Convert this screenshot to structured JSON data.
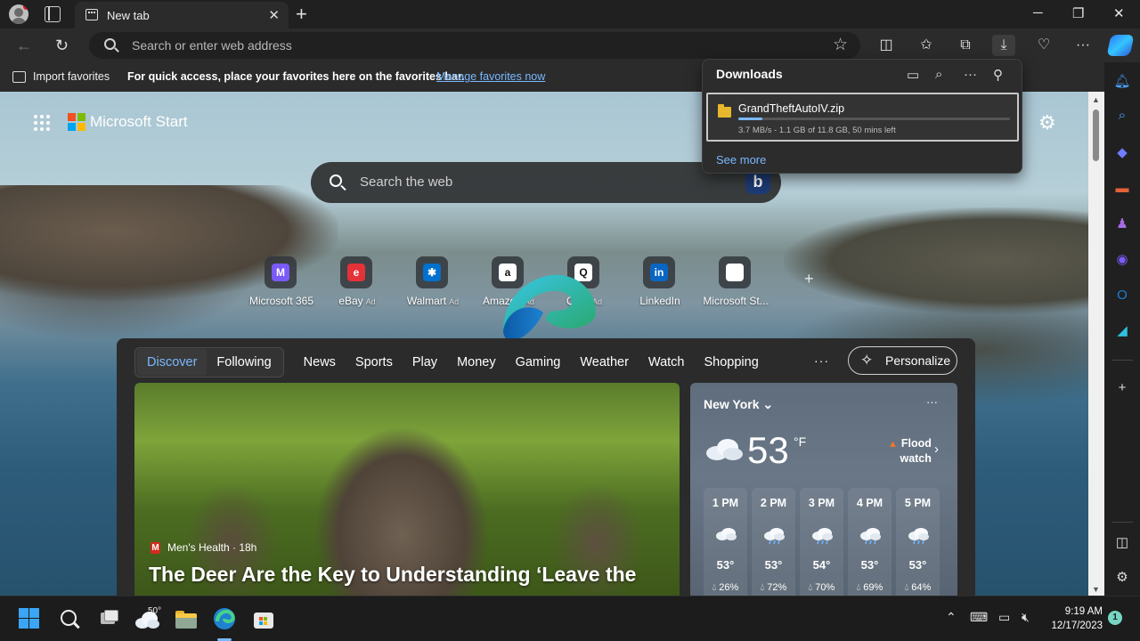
{
  "browser": {
    "tab": {
      "title": "New tab"
    },
    "address_bar": {
      "placeholder": "Search or enter web address"
    },
    "favorites_bar": {
      "import_label": "Import favorites",
      "message": "For quick access, place your favorites here on the favorites bar.",
      "manage_link": "Manage favorites now"
    }
  },
  "downloads": {
    "title": "Downloads",
    "items": [
      {
        "filename": "GrandTheftAutoIV.zip",
        "status": "3.7 MB/s - 1.1 GB of 11.8 GB, 50 mins left",
        "progress_percent": 9
      }
    ],
    "see_more": "See more"
  },
  "newtab": {
    "brand": "Microsoft Start",
    "search_placeholder": "Search the web",
    "quick_links": [
      {
        "label": "Microsoft 365",
        "ad": "",
        "color": "#7a5af8",
        "glyph": "M"
      },
      {
        "label": "eBay",
        "ad": "Ad",
        "color": "#e53238",
        "glyph": "e"
      },
      {
        "label": "Walmart",
        "ad": "Ad",
        "color": "#0071ce",
        "glyph": "✱"
      },
      {
        "label": "Amazon",
        "ad": "Ad",
        "color": "#ffffff",
        "glyph": "a"
      },
      {
        "label": "QVC",
        "ad": "Ad",
        "color": "#ffffff",
        "glyph": "Q"
      },
      {
        "label": "LinkedIn",
        "ad": "",
        "color": "#0a66c2",
        "glyph": "in"
      },
      {
        "label": "Microsoft St...",
        "ad": "",
        "color": "#ffffff",
        "glyph": ""
      }
    ],
    "feed_tabs": {
      "selected": "Discover",
      "secondary": "Following",
      "items": [
        "News",
        "Sports",
        "Play",
        "Money",
        "Gaming",
        "Weather",
        "Watch",
        "Shopping"
      ],
      "more": "···",
      "personalize": "Personalize"
    },
    "news_card": {
      "source": "Men's Health · 18h",
      "source_logo": "M",
      "headline": "The Deer Are the Key to Understanding ‘Leave the"
    },
    "weather": {
      "city": "New York",
      "temperature": "53",
      "unit": "°F",
      "alert_line1": "Flood",
      "alert_line2": "watch",
      "hourly": [
        {
          "time": "1 PM",
          "temp": "53°",
          "precip": "26%",
          "icon": "cloud-icon"
        },
        {
          "time": "2 PM",
          "temp": "53°",
          "precip": "72%",
          "icon": "rain-icon"
        },
        {
          "time": "3 PM",
          "temp": "54°",
          "precip": "70%",
          "icon": "rain-icon"
        },
        {
          "time": "4 PM",
          "temp": "53°",
          "precip": "69%",
          "icon": "heavy-rain-icon"
        },
        {
          "time": "5 PM",
          "temp": "53°",
          "precip": "64%",
          "icon": "heavy-rain-icon"
        }
      ]
    }
  },
  "taskbar": {
    "weather_temp": "50°",
    "time": "9:19 AM",
    "date": "12/17/2023",
    "notification_count": "1"
  }
}
